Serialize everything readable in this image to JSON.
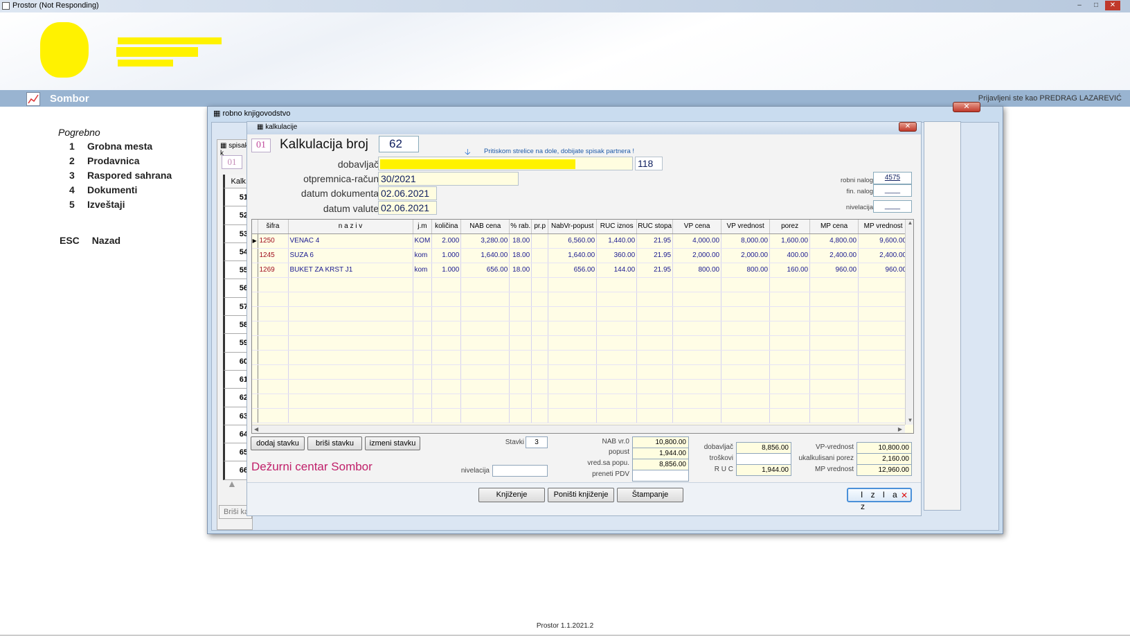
{
  "window": {
    "title": "Prostor (Not Responding)"
  },
  "header": {
    "city": "Sombor",
    "user_text": "Prijavljeni ste kao PREDRAG LAZAREVIĆ"
  },
  "menu": {
    "heading": "Pogrebno",
    "items": [
      {
        "num": "1",
        "label": "Grobna mesta"
      },
      {
        "num": "2",
        "label": "Prodavnica"
      },
      {
        "num": "3",
        "label": "Raspored sahrana"
      },
      {
        "num": "4",
        "label": "Dokumenti"
      },
      {
        "num": "5",
        "label": "Izveštaji"
      }
    ],
    "esc_key": "ESC",
    "esc_label": "Nazad"
  },
  "footer": {
    "version": "Prostor 1.1.2021.2"
  },
  "robno": {
    "caption": "robno knjigovodstvo"
  },
  "spisak": {
    "caption": "spisak k",
    "code": "01",
    "col_header": "Kalk.",
    "numbers": [
      "51",
      "52",
      "53",
      "54",
      "55",
      "56",
      "57",
      "58",
      "59",
      "60",
      "61",
      "62",
      "63",
      "64",
      "65",
      "66"
    ],
    "delete_button": "Briši ka"
  },
  "kalk": {
    "caption": "kalkulacije",
    "code": "01",
    "title": "Kalkulacija broj",
    "number": "62",
    "hint": "Pritiskom strelice na dole, dobijate spisak partnera !",
    "fields": {
      "dobavljac_label": "dobavljač",
      "dobavljac_code": "118",
      "otpremnica_label": "otpremnica-račun",
      "otpremnica_value": "30/2021",
      "datum_dok_label": "datum dokumenta",
      "datum_dok_value": "02.06.2021",
      "datum_val_label": "datum valute",
      "datum_val_value": "02.06.2021"
    },
    "side": {
      "robni_nalog_label": "robni nalog",
      "robni_nalog_value": "4575",
      "fin_nalog_label": "fin. nalog",
      "fin_nalog_value": "____",
      "nivelacija_label": "nivelacija",
      "nivelacija_value": "____"
    },
    "columns": [
      "šifra",
      "n a z i v",
      "j.m",
      "količina",
      "NAB cena",
      "% rab.",
      "pr.p",
      "NabVr-popust",
      "RUC iznos",
      "RUC stopa",
      "VP cena",
      "VP vrednost",
      "porez",
      "MP cena",
      "MP vrednost"
    ],
    "rows": [
      [
        "1250",
        "VENAC 4",
        "KOM",
        "2.000",
        "3,280.00",
        "18.00",
        "",
        "6,560.00",
        "1,440.00",
        "21.95",
        "4,000.00",
        "8,000.00",
        "1,600.00",
        "4,800.00",
        "9,600.00"
      ],
      [
        "1245",
        "SUZA 6",
        "kom",
        "1.000",
        "1,640.00",
        "18.00",
        "",
        "1,640.00",
        "360.00",
        "21.95",
        "2,000.00",
        "2,000.00",
        "400.00",
        "2,400.00",
        "2,400.00"
      ],
      [
        "1269",
        "BUKET ZA KRST J1",
        "kom",
        "1.000",
        "656.00",
        "18.00",
        "",
        "656.00",
        "144.00",
        "21.95",
        "800.00",
        "800.00",
        "160.00",
        "960.00",
        "960.00"
      ]
    ],
    "buttons": {
      "dodaj": "dodaj stavku",
      "brisi": "briši stavku",
      "izmeni": "izmeni stavku"
    },
    "stavki_label": "Stavki",
    "stavki_value": "3",
    "nivelacija_label": "nivelacija",
    "totals1": {
      "nab_label": "NAB vr.0",
      "nab_value": "10,800.00",
      "popust_label": "popust",
      "popust_value": "1,944.00",
      "vred_label": "vred.sa popu.",
      "vred_value": "8,856.00",
      "pdv_label": "preneti PDV",
      "pdv_value": ""
    },
    "totals2": {
      "dob_label": "dobavljač",
      "dob_value": "8,856.00",
      "trosk_label": "troškovi",
      "trosk_value": "",
      "ruc_label": "R U C",
      "ruc_value": "1,944.00"
    },
    "totals3": {
      "vp_label": "VP-vrednost",
      "vp_value": "10,800.00",
      "porez_label": "ukalkulisani porez",
      "porez_value": "2,160.00",
      "mp_label": "MP vrednost",
      "mp_value": "12,960.00"
    },
    "company": "Dežurni centar Sombor",
    "actions": {
      "knjizenje": "Knjiženje",
      "ponisti": "Poništi knjiženje",
      "stampanje": "Štampanje",
      "izlaz": "I z l a z"
    }
  }
}
